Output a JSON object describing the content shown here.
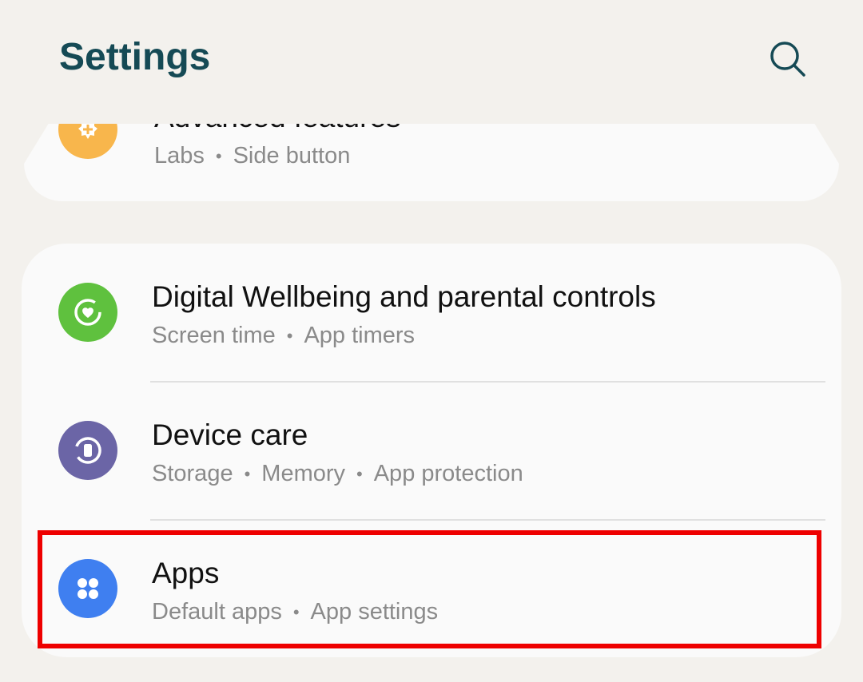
{
  "header": {
    "title": "Settings",
    "search_icon": "search-icon"
  },
  "advanced": {
    "title": "Advanced features",
    "sub": [
      "Labs",
      "Side button"
    ],
    "icon": "advanced-features-icon",
    "color": "#f8b64c"
  },
  "wellbeing": {
    "title": "Digital Wellbeing and parental controls",
    "sub": [
      "Screen time",
      "App timers"
    ],
    "icon": "digital-wellbeing-icon",
    "color": "#5fc13e"
  },
  "device_care": {
    "title": "Device care",
    "sub": [
      "Storage",
      "Memory",
      "App protection"
    ],
    "icon": "device-care-icon",
    "color": "#6b65a6"
  },
  "apps": {
    "title": "Apps",
    "sub": [
      "Default apps",
      "App settings"
    ],
    "icon": "apps-icon",
    "color": "#3f7ff0"
  },
  "highlight_color": "#ee0000",
  "separator": "•"
}
